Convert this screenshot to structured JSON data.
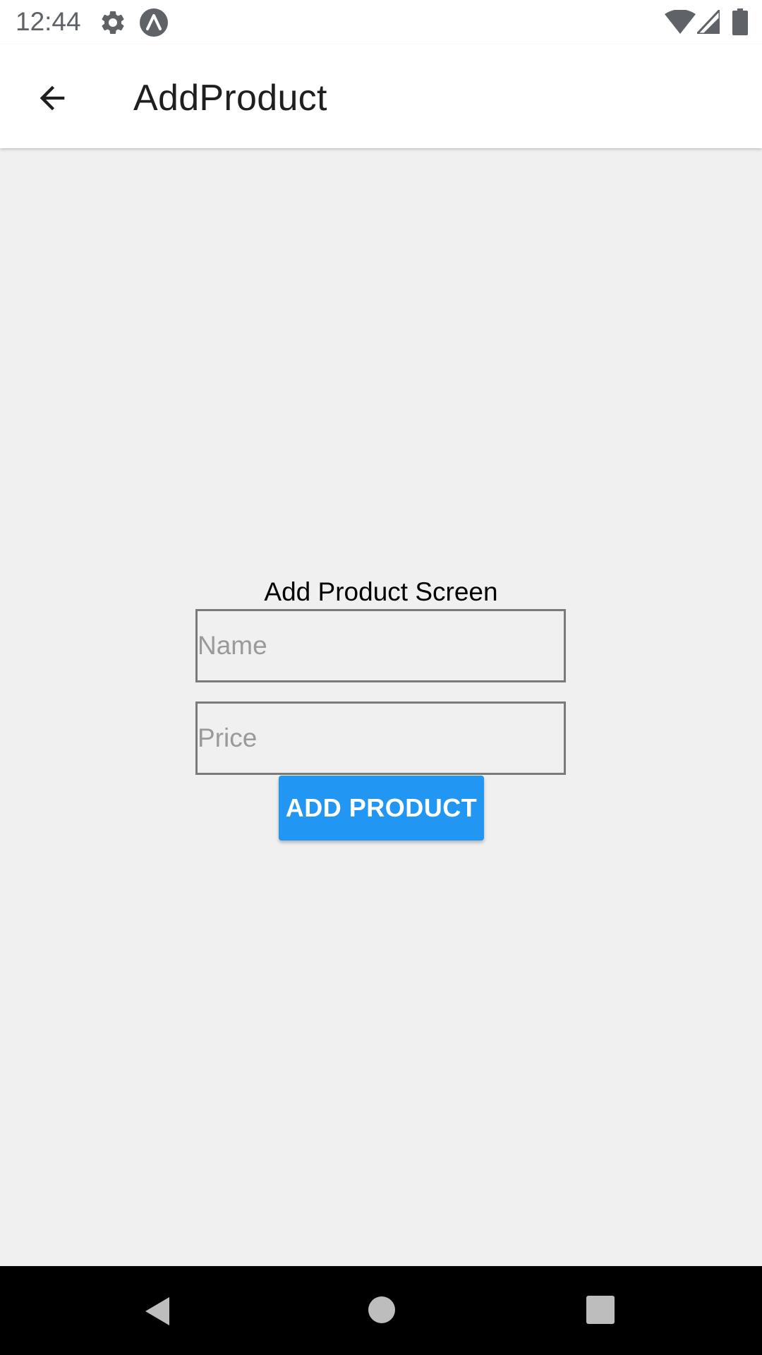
{
  "status_bar": {
    "time": "12:44",
    "icons": [
      "gear-icon",
      "app-notification-icon",
      "wifi-icon",
      "signal-icon",
      "battery-icon"
    ]
  },
  "app_bar": {
    "title": "AddProduct",
    "back_icon": "arrow-back-icon"
  },
  "form": {
    "heading": "Add Product Screen",
    "name_field": {
      "value": "",
      "placeholder": "Name"
    },
    "price_field": {
      "value": "",
      "placeholder": "Price"
    },
    "submit_label": "ADD PRODUCT"
  },
  "nav_bar": {
    "icons": [
      "nav-back-icon",
      "nav-home-icon",
      "nav-recents-icon"
    ]
  },
  "colors": {
    "accent": "#2196f3",
    "background": "#f0f0f0",
    "app_bar": "#ffffff",
    "nav_bar": "#000000"
  }
}
